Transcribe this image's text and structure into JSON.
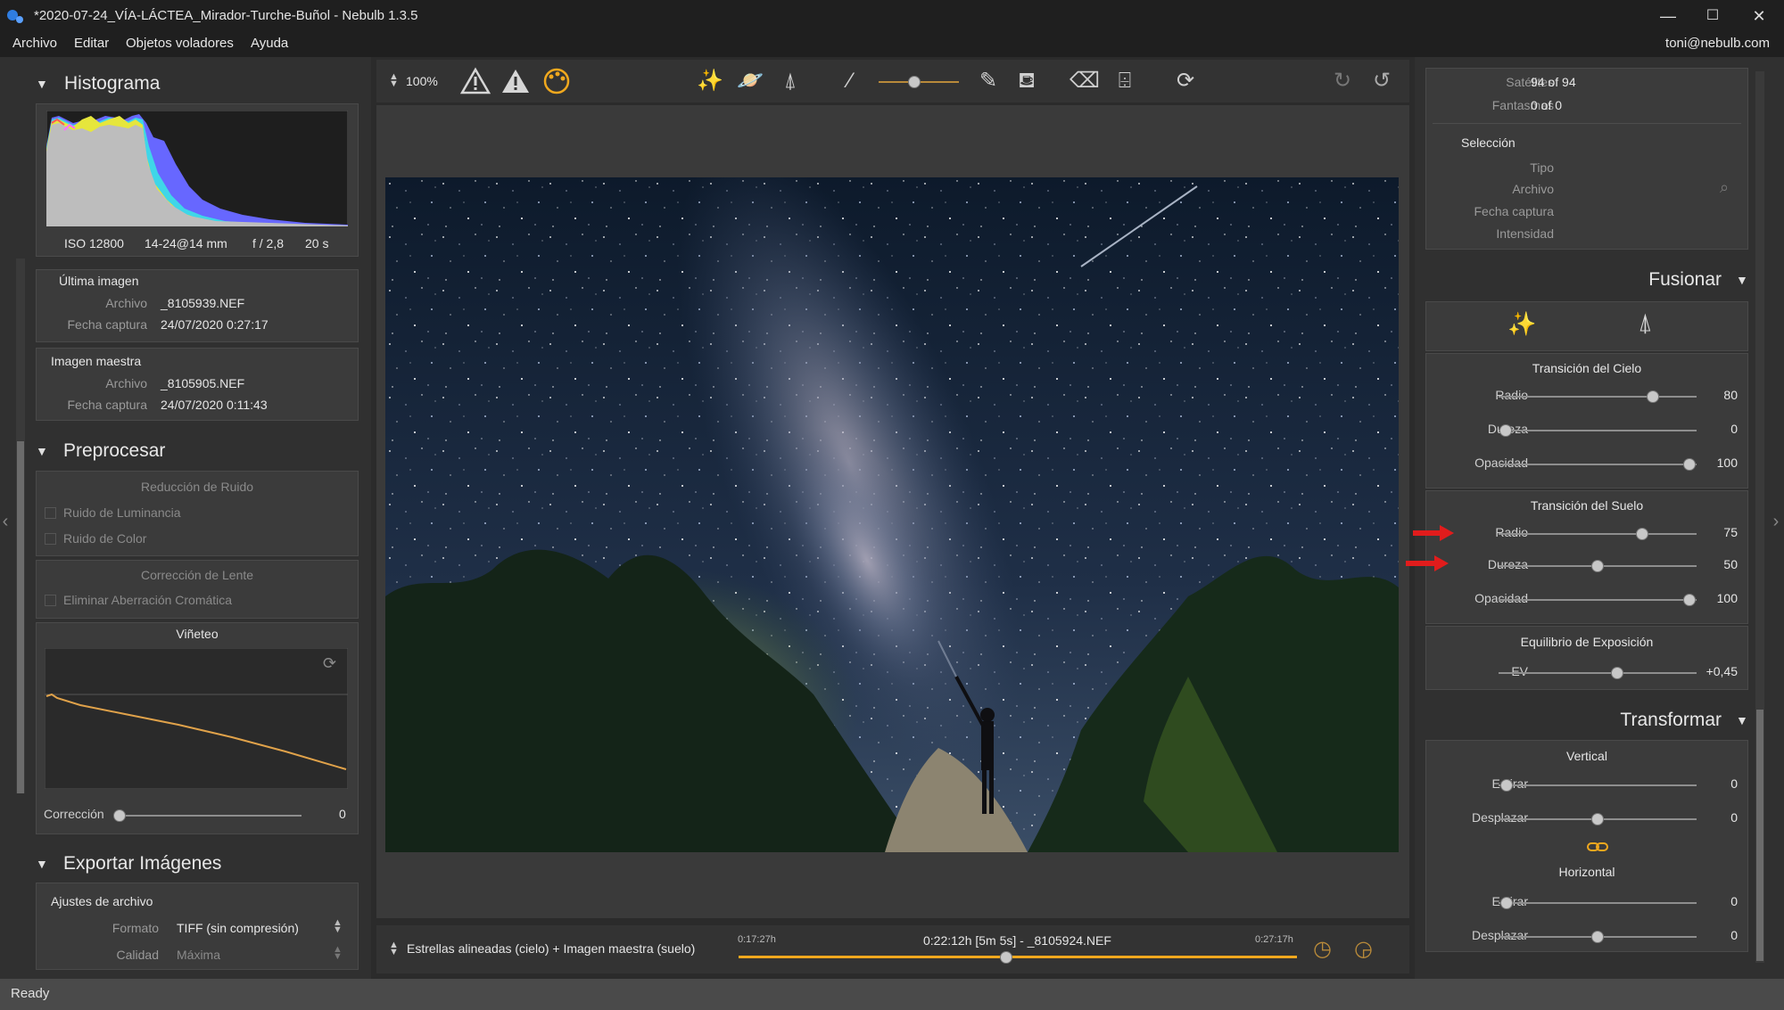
{
  "window": {
    "title": "*2020-07-24_VÍA-LÁCTEA_Mirador-Turche-Buñol - Nebulb 1.3.5",
    "minimize": "—",
    "maximize": "☐",
    "close": "✕"
  },
  "menu": {
    "items": [
      "Archivo",
      "Editar",
      "Objetos voladores",
      "Ayuda"
    ],
    "user": "toni@nebulb.com"
  },
  "histogram": {
    "title": "Histograma",
    "iso": "ISO 12800",
    "lens": "14-24@14 mm",
    "aperture": "f / 2,8",
    "exposure": "20 s"
  },
  "last_image": {
    "heading": "Última imagen",
    "file_label": "Archivo",
    "file": "_8105939.NEF",
    "date_label": "Fecha captura",
    "date": "24/07/2020 0:27:17"
  },
  "master_image": {
    "heading": "Imagen maestra",
    "file_label": "Archivo",
    "file": "_8105905.NEF",
    "date_label": "Fecha captura",
    "date": "24/07/2020 0:11:43"
  },
  "preprocess": {
    "title": "Preprocesar",
    "noise_heading": "Reducción de Ruido",
    "luminance_noise": "Ruido de Luminancia",
    "color_noise": "Ruido de Color",
    "lens_heading": "Corrección de Lente",
    "chromatic": "Eliminar Aberración Cromática",
    "vignette_heading": "Viñeteo",
    "correction_label": "Corrección",
    "correction_value": "0"
  },
  "export": {
    "title": "Exportar Imágenes",
    "file_settings": "Ajustes de archivo",
    "format_label": "Formato",
    "format_value": "TIFF (sin compresión)",
    "quality_label": "Calidad",
    "quality_value": "Máxima"
  },
  "toolbar": {
    "zoom": "100%"
  },
  "bottom": {
    "mode": "Estrellas alineadas (cielo) + Imagen maestra (suelo)",
    "start": "0:17:27h",
    "current": "0:22:12h [5m 5s] - _8105924.NEF",
    "end": "0:27:17h",
    "timeline_position": 0.48
  },
  "info": {
    "satellites_label": "Satélites",
    "satellites": "94 of 94",
    "ghosts_label": "Fantasmas",
    "ghosts": "0 of 0",
    "selection_heading": "Selección",
    "type_label": "Tipo",
    "file_label": "Archivo",
    "date_label": "Fecha captura",
    "intensity_label": "Intensidad"
  },
  "fusionar": {
    "title": "Fusionar",
    "sky_heading": "Transición del Cielo",
    "sky_radio_label": "Radio",
    "sky_radio": "80",
    "sky_dureza_label": "Dureza",
    "sky_dureza": "0",
    "sky_opacidad_label": "Opacidad",
    "sky_opacidad": "100",
    "ground_heading": "Transición del Suelo",
    "ground_radio_label": "Radio",
    "ground_radio": "75",
    "ground_dureza_label": "Dureza",
    "ground_dureza": "50",
    "ground_opacidad_label": "Opacidad",
    "ground_opacidad": "100",
    "exposure_heading": "Equilibrio de Exposición",
    "ev_label": "EV",
    "ev": "+0,45"
  },
  "transformar": {
    "title": "Transformar",
    "vertical_heading": "Vertical",
    "v_stretch_label": "Estirar",
    "v_stretch": "0",
    "v_shift_label": "Desplazar",
    "v_shift": "0",
    "horizontal_heading": "Horizontal",
    "h_stretch_label": "Estirar",
    "h_stretch": "0",
    "h_shift_label": "Desplazar",
    "h_shift": "0"
  },
  "status": {
    "text": "Ready"
  },
  "colors": {
    "accent": "#f0a81e",
    "arrow": "#e11c1c"
  }
}
